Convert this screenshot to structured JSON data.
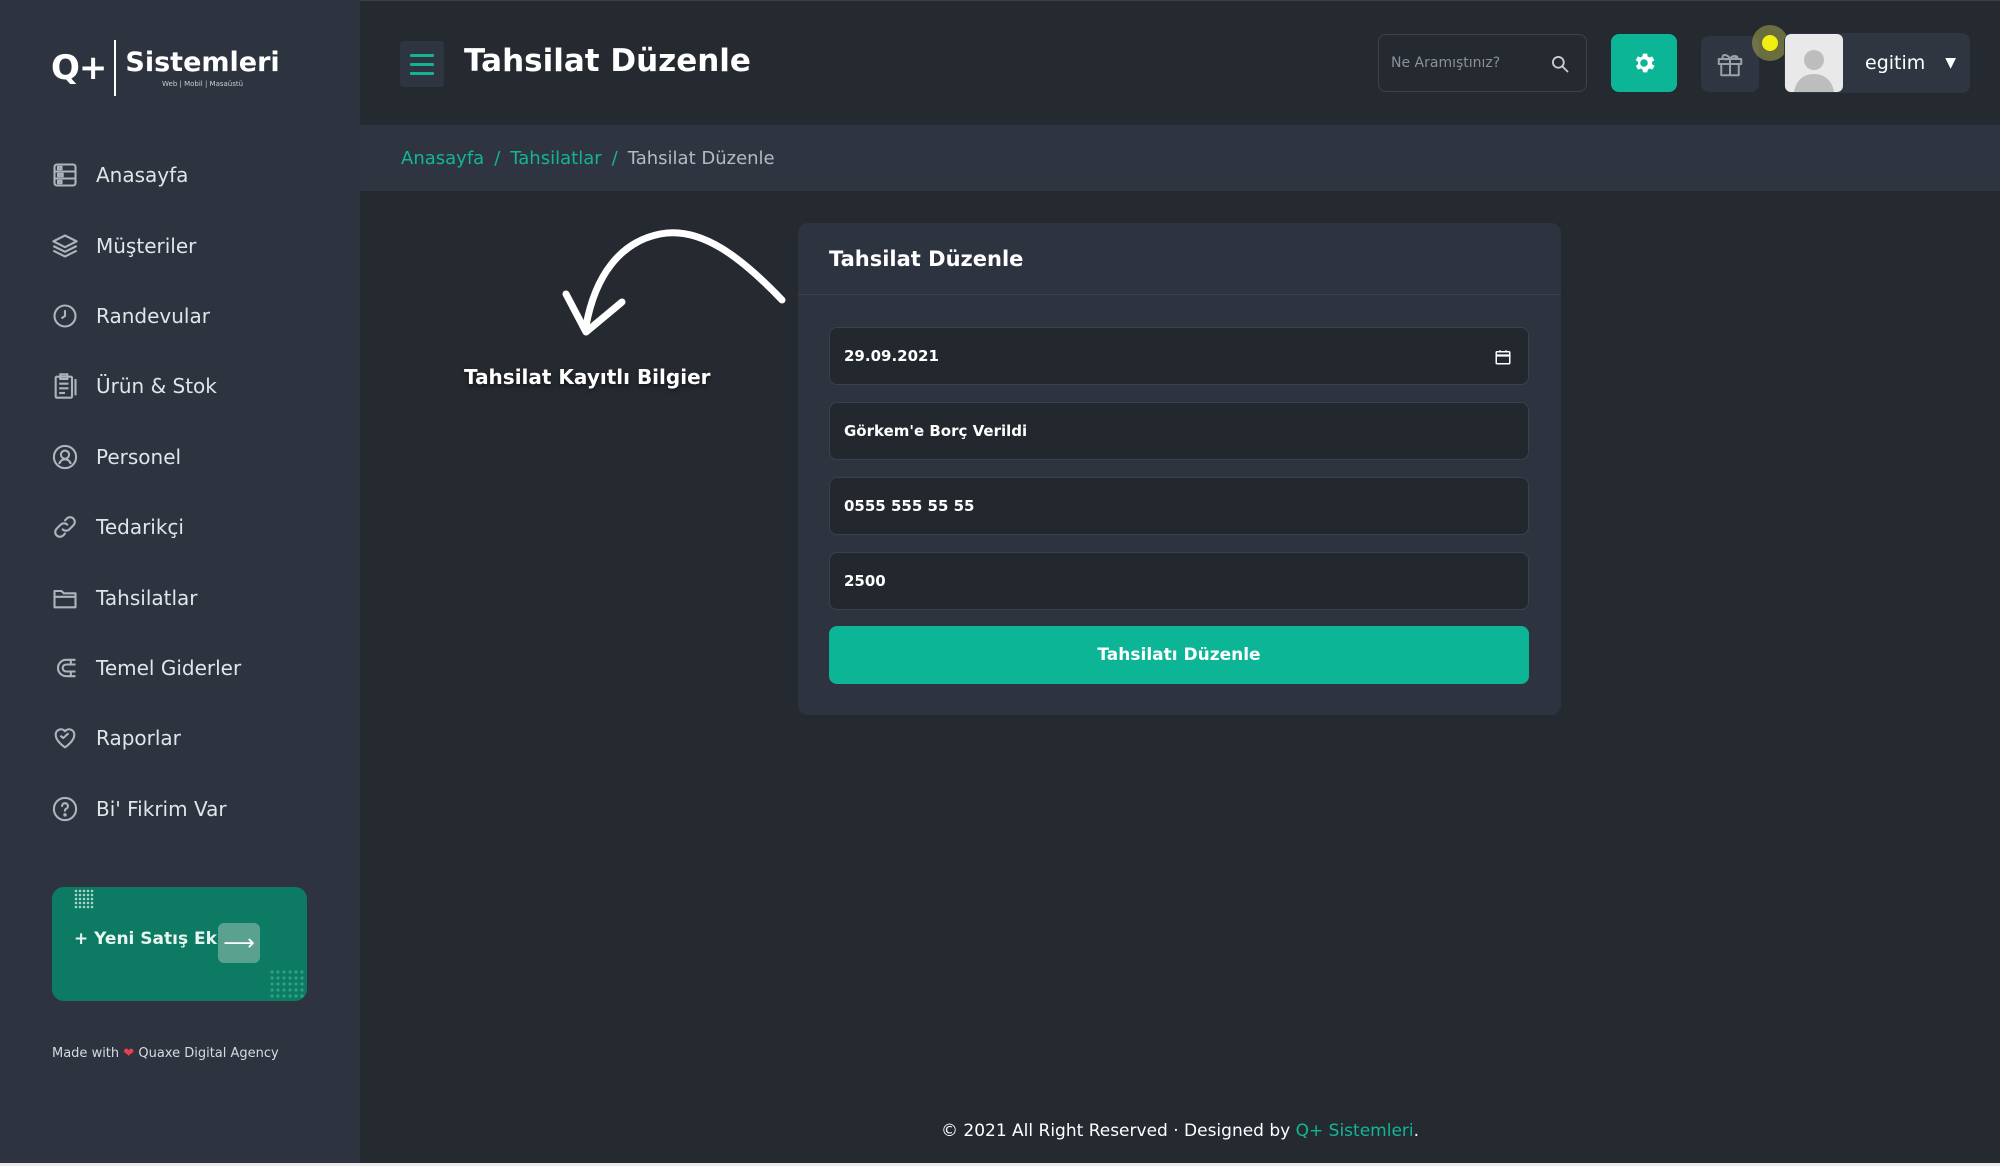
{
  "brand": {
    "mark": "Q+",
    "name": "Sistemleri",
    "tagline": "Web | Mobil | Masaüstü"
  },
  "sidebar": {
    "items": [
      {
        "label": "Anasayfa",
        "icon": "dashboard-icon"
      },
      {
        "label": "Müşteriler",
        "icon": "layers-icon"
      },
      {
        "label": "Randevular",
        "icon": "clock-icon"
      },
      {
        "label": "Ürün & Stok",
        "icon": "clipboard-icon"
      },
      {
        "label": "Personel",
        "icon": "user-circle-icon"
      },
      {
        "label": "Tedarikçi",
        "icon": "link-icon"
      },
      {
        "label": "Tahsilatlar",
        "icon": "folder-icon"
      },
      {
        "label": "Temel Giderler",
        "icon": "magnet-icon"
      },
      {
        "label": "Raporlar",
        "icon": "heart-icon"
      },
      {
        "label": "Bi' Fikrim Var",
        "icon": "help-icon"
      }
    ],
    "promo_label": "+ Yeni Satış Ekle",
    "made_with_prefix": "Made with",
    "made_with_suffix": "Quaxe Digital Agency"
  },
  "header": {
    "title": "Tahsilat Düzenle",
    "search_placeholder": "Ne Aramıştınız?",
    "user_name": "egitim"
  },
  "breadcrumb": {
    "items": [
      "Anasayfa",
      "Tahsilatlar"
    ],
    "separator": "/",
    "current": "Tahsilat Düzenle"
  },
  "annotation": {
    "text": "Tahsilat Kayıtlı Bilgier"
  },
  "form": {
    "title": "Tahsilat Düzenle",
    "date": "29.09.2021",
    "description": "Görkem'e Borç Verildi",
    "phone": "0555 555 55 55",
    "amount": "2500",
    "submit_label": "Tahsilatı Düzenle"
  },
  "footer": {
    "text": "© 2021 All Right Reserved · Designed by",
    "brand": "Q+ Sistemleri",
    "suffix": "."
  },
  "colors": {
    "accent": "#0db597",
    "sidebar_bg": "#2d3440",
    "page_bg": "#252a30",
    "notification": "#f1ee12"
  }
}
